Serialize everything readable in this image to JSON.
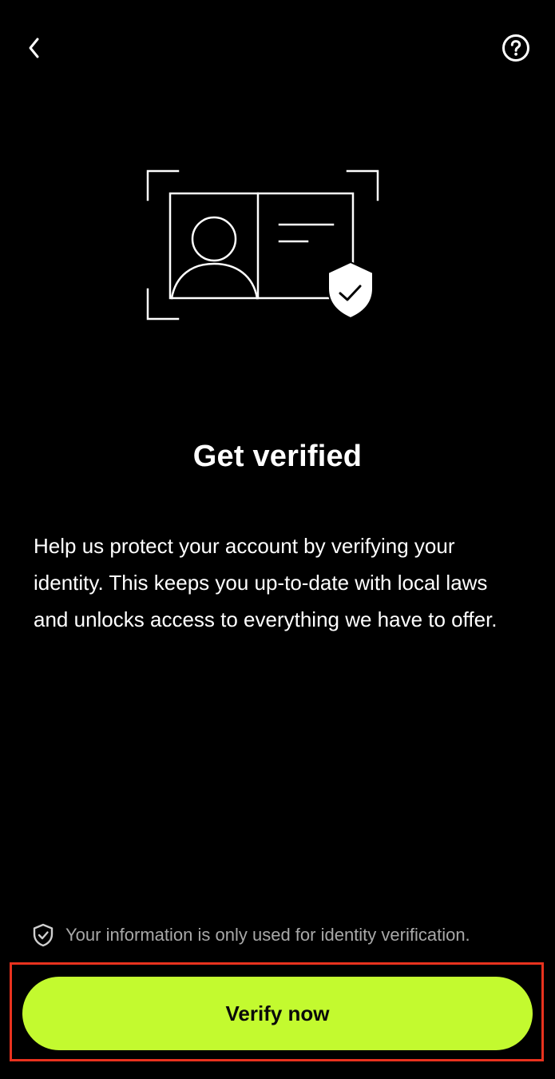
{
  "header": {
    "back_icon": "chevron-left-icon",
    "help_icon": "question-circle-icon"
  },
  "hero": {
    "illustration_icon": "id-card-shield-check-icon"
  },
  "main": {
    "title": "Get verified",
    "description": "Help us protect your account by verifying your identity. This keeps you up-to-date with local laws and unlocks access to everything we have to offer."
  },
  "footer": {
    "notice_icon": "shield-check-icon",
    "notice_text": "Your information is only used for identity verification.",
    "cta_label": "Verify now"
  },
  "colors": {
    "background": "#000000",
    "text": "#ffffff",
    "muted_text": "#a8a8a8",
    "accent": "#c3fa2f",
    "highlight_outline": "#e8321e"
  }
}
